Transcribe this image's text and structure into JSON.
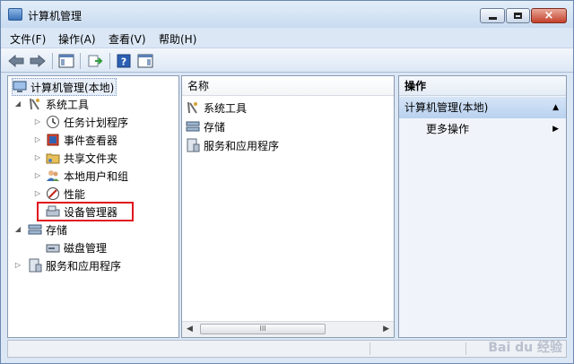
{
  "window": {
    "title": "计算机管理",
    "controls": {
      "minimize": "minimize",
      "maximize": "maximize",
      "close": "×"
    }
  },
  "menu": [
    "文件(F)",
    "操作(A)",
    "查看(V)",
    "帮助(H)"
  ],
  "tree": {
    "root": "计算机管理(本地)",
    "system_tools": "系统工具",
    "task_scheduler": "任务计划程序",
    "event_viewer": "事件查看器",
    "shared_folders": "共享文件夹",
    "local_users": "本地用户和组",
    "performance": "性能",
    "device_manager": "设备管理器",
    "storage": "存储",
    "disk_management": "磁盘管理",
    "services_apps": "服务和应用程序"
  },
  "middle": {
    "column_header": "名称",
    "items": [
      "系统工具",
      "存储",
      "服务和应用程序"
    ],
    "scroll_thumb": "III"
  },
  "actions": {
    "title": "操作",
    "group": "计算机管理(本地)",
    "more": "更多操作"
  },
  "colors": {
    "highlight": "#e0141d",
    "accent": "#b8d1ef"
  },
  "watermark": "Bai du 经验"
}
